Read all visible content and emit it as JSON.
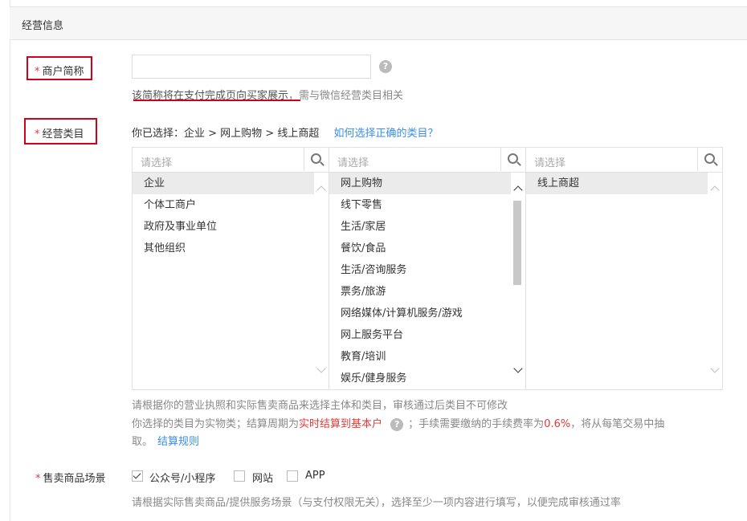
{
  "section": {
    "title": "经营信息"
  },
  "merchant_name": {
    "label": "商户简称",
    "value": "",
    "hint_underlined": "该简称将在支付完成页向买家展示",
    "hint_rest": "，需与微信经营类目相关"
  },
  "category": {
    "label": "经营类目",
    "selected_path": "你已选择：企业 > 网上购物 > 线上商超",
    "help_link": "如何选择正确的类目？",
    "columns": [
      {
        "placeholder": "请选择",
        "items": [
          "企业",
          "个体工商户",
          "政府及事业单位",
          "其他组织"
        ],
        "selected": "企业"
      },
      {
        "placeholder": "请选择",
        "items": [
          "网上购物",
          "线下零售",
          "生活/家居",
          "餐饮/食品",
          "生活/咨询服务",
          "票务/旅游",
          "网络媒体/计算机服务/游戏",
          "网上服务平台",
          "教育/培训",
          "娱乐/健身服务"
        ],
        "selected": "网上购物"
      },
      {
        "placeholder": "请选择",
        "items": [
          "线上商超"
        ],
        "selected": "线上商超"
      }
    ],
    "note1": "请根据你的营业执照和实际售卖商品来选择主体和类目，审核通过后类目不可修改",
    "note2_pre": "你选择的类目为实物类；结算周期为",
    "note2_cycle": "实时结算到基本户",
    "note2_mid": "；手续需要缴纳的手续费率为",
    "note2_rate": "0.6%",
    "note2_post": "，将从每笔交易中抽",
    "note3_pre": "取。",
    "note3_link": "结算规则"
  },
  "scenes": {
    "label": "售卖商品场景",
    "options": [
      {
        "label": "公众号/小程序",
        "checked": true
      },
      {
        "label": "网站",
        "checked": false
      },
      {
        "label": "APP",
        "checked": false
      }
    ],
    "hint": "请根据实际售卖商品/提供服务场景（与支付权限无关），选择至少一项内容进行填写，以便完成审核通过率"
  },
  "colors": {
    "required": "#e03b3b",
    "link": "#3a8ee6",
    "highlight_box": "#d0021b"
  },
  "icons": {
    "help": "question-circle-icon",
    "search": "search-icon"
  }
}
